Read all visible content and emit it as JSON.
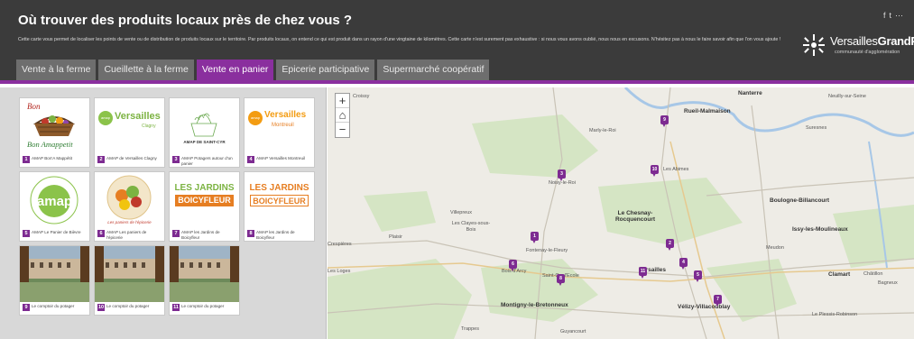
{
  "header": {
    "title": "Où trouver des produits locaux près de chez vous ?",
    "description": "Cette carte vous permet de localiser les points de vente ou de distribution de produits locaux sur le territoire. Par produits locaux, on entend ce qui est produit dans un rayon d'une vingtaine de kilomètres. Cette carte n'est surement pas exhaustive : si nous vous avons oublié, nous nous en excusons. N'hésitez pas à nous le faire savoir afin que l'on vous ajoute !",
    "social_icons": [
      "facebook-icon",
      "twitter-icon",
      "share-icon"
    ],
    "brand": {
      "name_light": "Versailles",
      "name_bold": "GrandParc",
      "subtitle": "communauté d'agglomération"
    }
  },
  "tabs": [
    {
      "label": "Vente à la ferme",
      "active": false
    },
    {
      "label": "Cueillette à la ferme",
      "active": false
    },
    {
      "label": "Vente en panier",
      "active": true
    },
    {
      "label": "Epicerie participative",
      "active": false
    },
    {
      "label": "Supermarché coopératif",
      "active": false
    }
  ],
  "cards": [
    {
      "num": "1",
      "caption": "AMAP Bon'A Mappétit",
      "logo_text": "Bon Amappetit",
      "logo": "basket"
    },
    {
      "num": "2",
      "caption": "AMAP de Versailles Clagny",
      "logo_text": "Versailles",
      "logo_sub": "Clagny",
      "logo": "versailles"
    },
    {
      "num": "3",
      "caption": "AMAP Potagers autour d'un panier",
      "logo_text": "AMAP DE SAINT-CYR",
      "logo": "sketch"
    },
    {
      "num": "4",
      "caption": "AMAP Versailles Montreuil",
      "logo_text": "Versailles",
      "logo_sub": "Montreuil",
      "logo": "versailles"
    },
    {
      "num": "5",
      "caption": "AMAP Le Panier de Bièvre",
      "logo_text": "amap",
      "logo": "amap"
    },
    {
      "num": "6",
      "caption": "AMAP Les paniers de l'épicerie",
      "logo_text": "Les paniers de l'épicerie",
      "logo": "veg"
    },
    {
      "num": "7",
      "caption": "AMAP les Jardins de Boicyfleur",
      "logo_text": "LES JARDINS",
      "logo_sub": "BOICYFLEUR",
      "logo": "jardins"
    },
    {
      "num": "8",
      "caption": "AMAP les Jardins de Boicyfleur",
      "logo_text": "LES JARDINS",
      "logo_sub": "BOICYFLEUR",
      "logo": "jardins"
    },
    {
      "num": "9",
      "caption": "Le comptoir du potager",
      "logo": "building"
    },
    {
      "num": "10",
      "caption": "Le comptoir du potager",
      "logo": "building"
    },
    {
      "num": "11",
      "caption": "Le comptoir du potager",
      "logo": "building"
    }
  ],
  "map": {
    "zoom_in": "+",
    "home_icon": "home-icon",
    "zoom_out": "−",
    "places": [
      {
        "name": "Nanterre",
        "big": true
      },
      {
        "name": "Neuilly-sur-Seine",
        "big": false
      },
      {
        "name": "Rueil-Malmaison",
        "big": true
      },
      {
        "name": "Suresnes",
        "big": false
      },
      {
        "name": "Marly-le-Roi",
        "big": false
      },
      {
        "name": "Noisy-le-Roi",
        "big": false
      },
      {
        "name": "Les Abimes",
        "big": false
      },
      {
        "name": "Villepreux",
        "big": false
      },
      {
        "name": "Le Chesnay-Rocquencourt",
        "big": true
      },
      {
        "name": "Boulogne-Billancourt",
        "big": true
      },
      {
        "name": "Les Clayes-sous-Bois",
        "big": false
      },
      {
        "name": "Plaisir",
        "big": false
      },
      {
        "name": "Issy-les-Moulineaux",
        "big": true
      },
      {
        "name": "Fontenay-le-Fleury",
        "big": false
      },
      {
        "name": "Meudon",
        "big": false
      },
      {
        "name": "Versailles",
        "big": true
      },
      {
        "name": "Bois d'Arcy",
        "big": false
      },
      {
        "name": "Saint-Cyr-l'Ecole",
        "big": false
      },
      {
        "name": "Clamart",
        "big": true
      },
      {
        "name": "Châtillon",
        "big": false
      },
      {
        "name": "Bagneux",
        "big": false
      },
      {
        "name": "Montigny-le-Bretonneux",
        "big": true
      },
      {
        "name": "Vélizy-Villacoublay",
        "big": true
      },
      {
        "name": "Trappes",
        "big": false
      },
      {
        "name": "Guyancourt",
        "big": false
      },
      {
        "name": "Le Plessis-Robinson",
        "big": false
      },
      {
        "name": "Croissy",
        "big": false
      },
      {
        "name": "Crespières",
        "big": false
      },
      {
        "name": "Les Loges",
        "big": false
      }
    ],
    "markers": [
      "9",
      "3",
      "10",
      "1",
      "2",
      "4",
      "5",
      "6",
      "8",
      "7",
      "11"
    ]
  }
}
